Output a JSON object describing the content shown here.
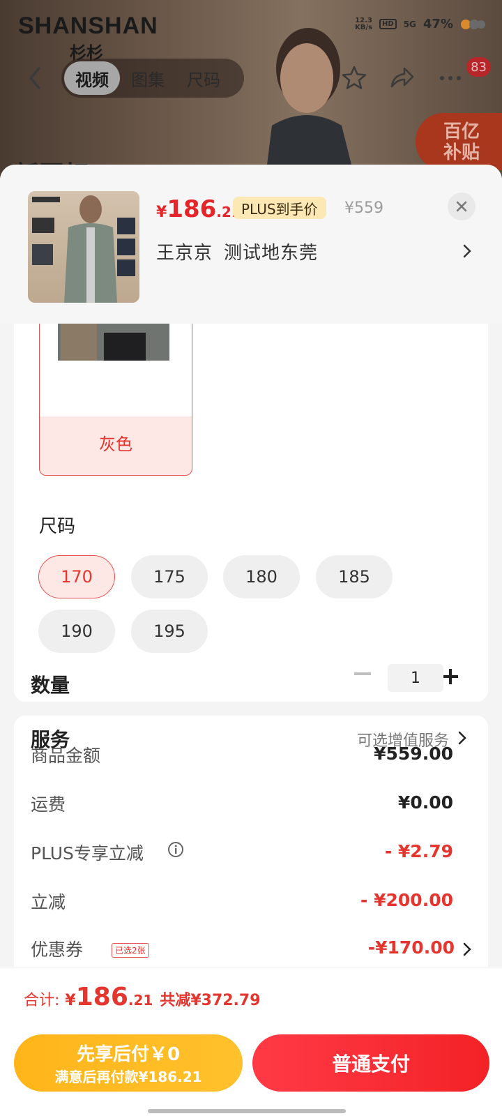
{
  "background": {
    "brand": "SHANSHAN",
    "brand_sub": "杉杉",
    "status": {
      "net_speed": "12.3",
      "net_unit": "KB/s",
      "hd": "HD",
      "signal": "5G",
      "battery": "47%"
    },
    "tabs": [
      {
        "label": "视频",
        "active": true
      },
      {
        "label": "图集",
        "active": false
      },
      {
        "label": "尺码",
        "active": false
      }
    ],
    "cart_badge": "83",
    "subsidy_line1": "百亿",
    "subsidy_line2": "补贴",
    "hero_text": "新国标"
  },
  "sheet": {
    "price_yen": "¥",
    "price_int": "186",
    "price_dec": ".21",
    "plus_tag": "PLUS到手价",
    "original_price": "¥559",
    "address_name": "王京京",
    "address_text": "测试地东莞"
  },
  "options": {
    "color_label": "灰色",
    "size_title": "尺码",
    "sizes": [
      {
        "label": "170",
        "selected": true
      },
      {
        "label": "175",
        "selected": false
      },
      {
        "label": "180",
        "selected": false
      },
      {
        "label": "185",
        "selected": false
      },
      {
        "label": "190",
        "selected": false
      },
      {
        "label": "195",
        "selected": false
      }
    ],
    "quantity_label": "数量",
    "quantity": "1",
    "service_label": "服务",
    "service_hint": "可选增值服务"
  },
  "fees": [
    {
      "label": "商品金额",
      "value": "¥559.00",
      "red": false
    },
    {
      "label": "运费",
      "value": "¥0.00",
      "red": false
    },
    {
      "label": "PLUS专享立减",
      "value": "- ¥2.79",
      "red": true
    },
    {
      "label": "立减",
      "value": "- ¥200.00",
      "red": true
    },
    {
      "label": "优惠券",
      "value": "-¥170.00",
      "red": true,
      "tag": "已选2张"
    }
  ],
  "footer": {
    "total_label": "合计:",
    "total_yen": "¥",
    "total_int": "186",
    "total_dec": ".21",
    "total_save": "共减¥372.79",
    "pay_later_line1": "先享后付￥0",
    "pay_later_line2": "满意后再付款¥186.21",
    "pay_button": "普通支付"
  },
  "colors": {
    "accent_red": "#e4352e",
    "pay_later_orange": "#ffb51a",
    "plus_tag_bg": "#fbe8b4"
  }
}
